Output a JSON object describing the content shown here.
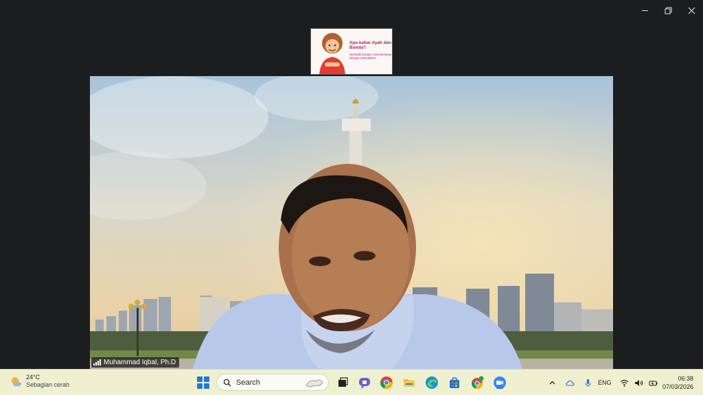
{
  "window": {
    "controls": [
      "minimize-icon",
      "restore-icon",
      "close-icon"
    ]
  },
  "shared_content": {
    "title": "Apa kabar Ayah dan Bunda?",
    "subtitle": "Mendidik Dengan Cinta Bersikap Dengan Kelembutan"
  },
  "video": {
    "participant_name": "Muhammad Iqbal, Ph.D",
    "signal_icon": "signal-bars-icon"
  },
  "taskbar": {
    "weather": {
      "temp": "24°C",
      "desc": "Sebagian cerah",
      "icon": "partly-sunny-icon"
    },
    "search": {
      "placeholder": "Search"
    },
    "apps": [
      "task-view-icon",
      "teams-icon",
      "chrome-icon",
      "file-explorer-icon",
      "edge-icon",
      "store-icon",
      "chrome-profile-icon",
      "zoom-icon"
    ],
    "tray": {
      "lang": "ENG",
      "time": "06:38",
      "date": "07/03/2026"
    },
    "colors": {
      "accent": "#3c78d8",
      "background": "#eef0cf"
    }
  }
}
